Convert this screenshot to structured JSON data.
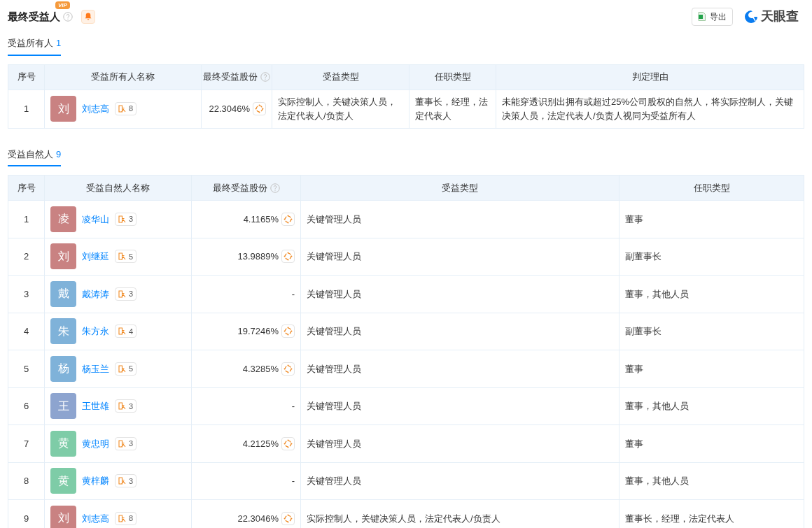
{
  "header": {
    "title": "最终受益人",
    "vip_badge": "VIP",
    "export_button": "导出",
    "logo_text": "天眼查"
  },
  "owners": {
    "tab": {
      "label": "受益所有人",
      "count": "1"
    },
    "columns": [
      "序号",
      "受益所有人名称",
      "最终受益股份",
      "受益类型",
      "任职类型",
      "判定理由"
    ],
    "rows": [
      {
        "index": "1",
        "avatar": "刘",
        "color": "#c98282",
        "name": "刘志高",
        "relations": "8",
        "share": "22.3046%",
        "benefit_type": "实际控制人，关键决策人员，法定代表人/负责人",
        "position": "董事长，经理，法定代表人",
        "reason": "未能穿透识别出拥有或超过25%公司股权的自然人，将实际控制人，关键决策人员，法定代表人/负责人视同为受益所有人"
      }
    ]
  },
  "persons": {
    "tab": {
      "label": "受益自然人",
      "count": "9"
    },
    "columns": [
      "序号",
      "受益自然人名称",
      "最终受益股份",
      "受益类型",
      "任职类型"
    ],
    "rows": [
      {
        "index": "1",
        "avatar": "凌",
        "color": "#c98282",
        "name": "凌华山",
        "relations": "3",
        "share": "4.1165%",
        "benefit_type": "关键管理人员",
        "position": "董事"
      },
      {
        "index": "2",
        "avatar": "刘",
        "color": "#c98282",
        "name": "刘继延",
        "relations": "5",
        "share": "13.9889%",
        "benefit_type": "关键管理人员",
        "position": "副董事长"
      },
      {
        "index": "3",
        "avatar": "戴",
        "color": "#7fb2d9",
        "name": "戴涛涛",
        "relations": "3",
        "share": "-",
        "benefit_type": "关键管理人员",
        "position": "董事，其他人员"
      },
      {
        "index": "4",
        "avatar": "朱",
        "color": "#7fb2d9",
        "name": "朱方永",
        "relations": "4",
        "share": "19.7246%",
        "benefit_type": "关键管理人员",
        "position": "副董事长"
      },
      {
        "index": "5",
        "avatar": "杨",
        "color": "#7fb2d9",
        "name": "杨玉兰",
        "relations": "5",
        "share": "4.3285%",
        "benefit_type": "关键管理人员",
        "position": "董事"
      },
      {
        "index": "6",
        "avatar": "王",
        "color": "#8da4cf",
        "name": "王世雄",
        "relations": "3",
        "share": "-",
        "benefit_type": "关键管理人员",
        "position": "董事，其他人员"
      },
      {
        "index": "7",
        "avatar": "黄",
        "color": "#7ecca7",
        "name": "黄忠明",
        "relations": "3",
        "share": "4.2125%",
        "benefit_type": "关键管理人员",
        "position": "董事"
      },
      {
        "index": "8",
        "avatar": "黄",
        "color": "#7ecca7",
        "name": "黄梓麟",
        "relations": "3",
        "share": "-",
        "benefit_type": "关键管理人员",
        "position": "董事，其他人员"
      },
      {
        "index": "9",
        "avatar": "刘",
        "color": "#c98282",
        "name": "刘志高",
        "relations": "8",
        "share": "22.3046%",
        "benefit_type": "实际控制人，关键决策人员，法定代表人/负责人",
        "position": "董事长，经理，法定代表人"
      }
    ]
  }
}
